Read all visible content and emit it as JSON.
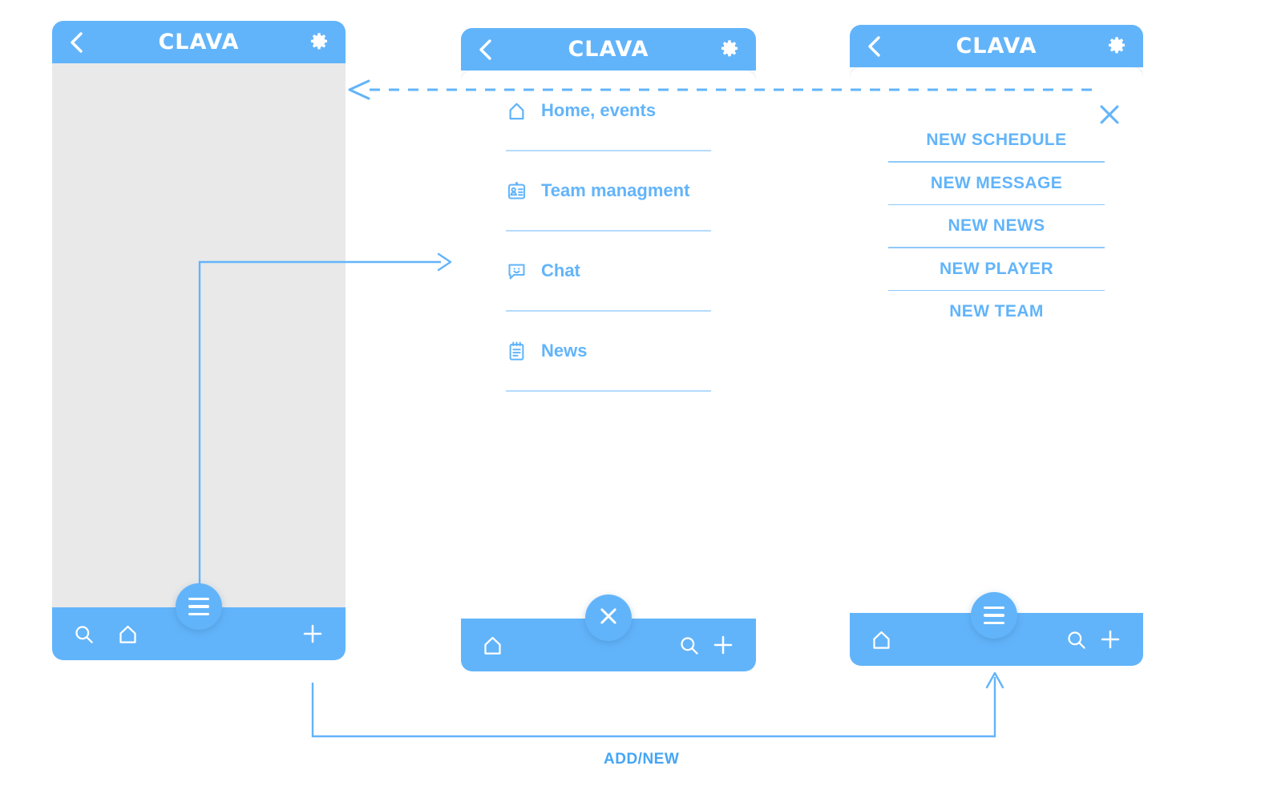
{
  "app": {
    "brand": "CLAVA",
    "accent": "#62b4fa",
    "accent_dark": "#45a5f5",
    "divider_light": "#b5dcfd",
    "divider_mid": "#8ec9fb",
    "screen_grey": "#e9e9e9"
  },
  "screens": [
    {
      "id": "home-screen",
      "header": {
        "back": "back-chevron",
        "title": "CLAVA",
        "settings": "gear-icon"
      },
      "bottom_bar": {
        "left_icons": [
          "search-icon",
          "home-icon"
        ],
        "right_icons": [
          "plus-icon"
        ],
        "fab": "hamburger-menu-icon"
      }
    },
    {
      "id": "menu-screen",
      "header": {
        "back": "back-chevron",
        "title": "CLAVA",
        "settings": "gear-icon"
      },
      "menu_items": [
        {
          "icon": "home-icon",
          "label": "Home, events"
        },
        {
          "icon": "id-badge-icon",
          "label": "Team managment"
        },
        {
          "icon": "chat-bubble-icon",
          "label": "Chat"
        },
        {
          "icon": "notepad-icon",
          "label": "News"
        }
      ],
      "bottom_bar": {
        "left_icons": [
          "home-icon"
        ],
        "right_icons": [
          "search-icon",
          "plus-icon"
        ],
        "fab": "close-x-icon"
      }
    },
    {
      "id": "add-new-screen",
      "header": {
        "back": "back-chevron",
        "title": "CLAVA",
        "settings": "gear-icon"
      },
      "close": "close-x-icon",
      "actions": [
        "NEW SCHEDULE",
        "NEW MESSAGE",
        "NEW NEWS",
        "NEW PLAYER",
        "NEW TEAM"
      ],
      "bottom_bar": {
        "left_icons": [
          "home-icon"
        ],
        "right_icons": [
          "search-icon",
          "plus-icon"
        ],
        "fab": "hamburger-menu-icon"
      }
    }
  ],
  "flow": {
    "add_new_label": "ADD/NEW"
  }
}
